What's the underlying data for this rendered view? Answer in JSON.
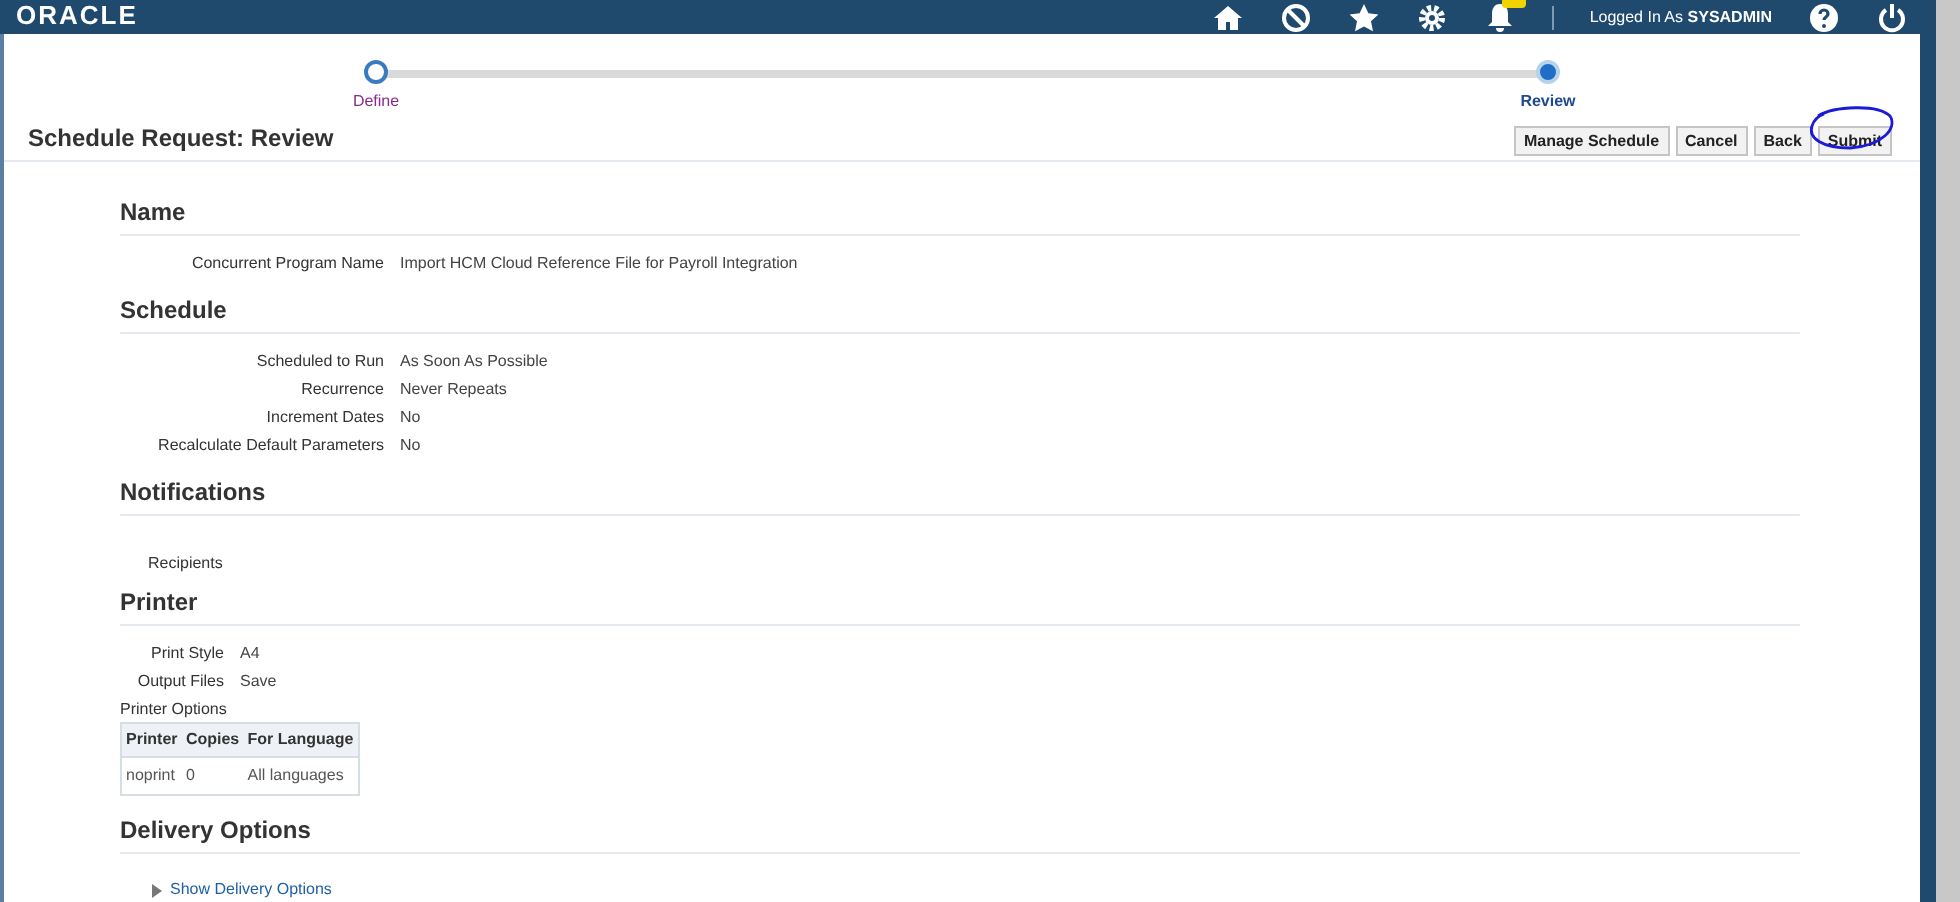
{
  "header": {
    "logo": "ORACLE",
    "logged_in_label": "Logged In As",
    "user": "SYSADMIN"
  },
  "train": [
    {
      "label": "Define",
      "selected": false
    },
    {
      "label": "Review",
      "selected": true
    }
  ],
  "page_title": "Schedule Request: Review",
  "buttons": [
    {
      "label": "Manage Schedule",
      "circled": false
    },
    {
      "label": "Cancel",
      "circled": false
    },
    {
      "label": "Back",
      "circled": false
    },
    {
      "label": "Submit",
      "circled": true
    }
  ],
  "sections": [
    {
      "kind": "fields",
      "title": "Name",
      "fields": [
        {
          "label": "Concurrent Program Name",
          "value": "Import HCM Cloud Reference File for Payroll Integration"
        }
      ]
    },
    {
      "kind": "fields",
      "title": "Schedule",
      "fields": [
        {
          "label": "Scheduled to Run",
          "value": "As Soon As Possible"
        },
        {
          "label": "Recurrence",
          "value": "Never Repeats"
        },
        {
          "label": "Increment Dates",
          "value": "No"
        },
        {
          "label": "Recalculate Default Parameters",
          "value": "No"
        }
      ]
    },
    {
      "kind": "list",
      "title": "Notifications",
      "label": "Recipients"
    },
    {
      "kind": "printer",
      "title": "Printer",
      "fields": [
        {
          "label": "Print Style",
          "value": "A4"
        },
        {
          "label": "Output Files",
          "value": "Save"
        }
      ],
      "options_label": "Printer Options",
      "columns": [
        "Printer",
        "Copies",
        "For Language"
      ],
      "rows": [
        [
          "noprint",
          "0",
          "All languages"
        ]
      ]
    },
    {
      "kind": "disclosure",
      "title": "Delivery Options",
      "link": "Show Delivery Options"
    }
  ]
}
